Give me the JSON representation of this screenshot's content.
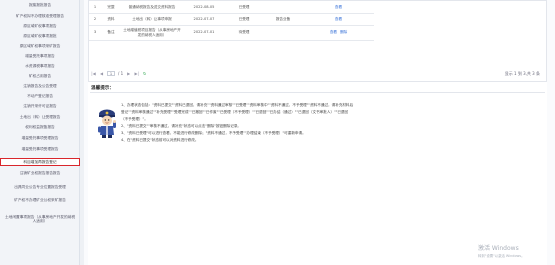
{
  "sidebar": {
    "items": [
      {
        "label": "报废报批报告"
      },
      {
        "label": "矿产权拟不办理核准受理报告"
      },
      {
        "label": "原区域矿权事项报告"
      },
      {
        "label": "原区域矿权事项报批"
      },
      {
        "label": "原区域矿权事项采矿报告"
      },
      {
        "label": "增量受托事项报告"
      },
      {
        "label": "水资源税事项报告"
      },
      {
        "label": "矿权占用报告"
      },
      {
        "label": "注销报告及公告受理"
      },
      {
        "label": "不动产登记报告"
      },
      {
        "label": "注销开采许可证报告"
      },
      {
        "label": "土地出（转）让受理报告"
      },
      {
        "label": "权利权益报备报告"
      },
      {
        "label": "增量受托事项受理报告"
      },
      {
        "label": "增量受托事项受理报告"
      },
      {
        "label": "科目增加再报告登记"
      },
      {
        "label": "注销矿业权报告报告报告"
      },
      {
        "label": "出具同业公告专业位置报告受理"
      },
      {
        "label": "矿产权不办理矿业公权采矿报告"
      },
      {
        "label": "土地闲置事项报告（从事房地产开发的纳税人适用）"
      }
    ]
  },
  "table": {
    "rows": [
      {
        "no": "1",
        "type": "完整",
        "title": "普通纳税报告及送交资料报告",
        "date": "2022-08-05",
        "status": "已受理",
        "remark": "",
        "ops": [
          "查看"
        ]
      },
      {
        "no": "2",
        "type": "资料",
        "title": "土地出（转）让事项申报",
        "date": "2022-07-07",
        "status": "已受理",
        "remark": "报告业备",
        "ops": [
          "查看"
        ]
      },
      {
        "no": "3",
        "type": "备注",
        "title": "土地增值税项目报告（从事房地产开发的纳税人适用）",
        "date": "2022-07-01",
        "status": "待受理",
        "remark": "",
        "ops": [
          "查看",
          "删除"
        ]
      }
    ]
  },
  "pager": {
    "prev_first": "|◀",
    "prev": "◀",
    "current_page": "1",
    "total": "/ 1",
    "next": "▶",
    "next_last": "▶|",
    "refresh": "↻",
    "info": "显示 1 到 3,共 3 条"
  },
  "notice": {
    "title": "温馨提示：",
    "lines": [
      "1、办理状态包括：\"资料已提交\"\"资料已退回，请补充\"\"资料通过审核\"\"已受理\"\"资料审核中\"\"资料不通过，不予受理\"\"资料不通过，请补充材料后",
      "登记\"\"资料审核通过\"\"补充受理\"\"受理完成\"\"已撤回\"\"已作废\"\"已受理（不予受理）\"\"已退回\"\"已办结（通过）\"\"已退回（文书审批人）\"\"已退回",
      "（不予受理）\"。",
      "2、\"资料已提交\"\"审核不通过，请补充\"状态可以点击\"删除\"按钮删除记录。",
      "3、\"资料已受理\"可以进行查看，不能进行修改删除；\"资料不通过，不予受理\"\"办理结束（不予受理）\"可重新申请。",
      "4、在\"资料已提交\"状态前可以对资料进行修改。"
    ]
  },
  "watermark": {
    "line1": "激活 Windows",
    "line2": "转到\"设置\"以激活 Windows。"
  }
}
